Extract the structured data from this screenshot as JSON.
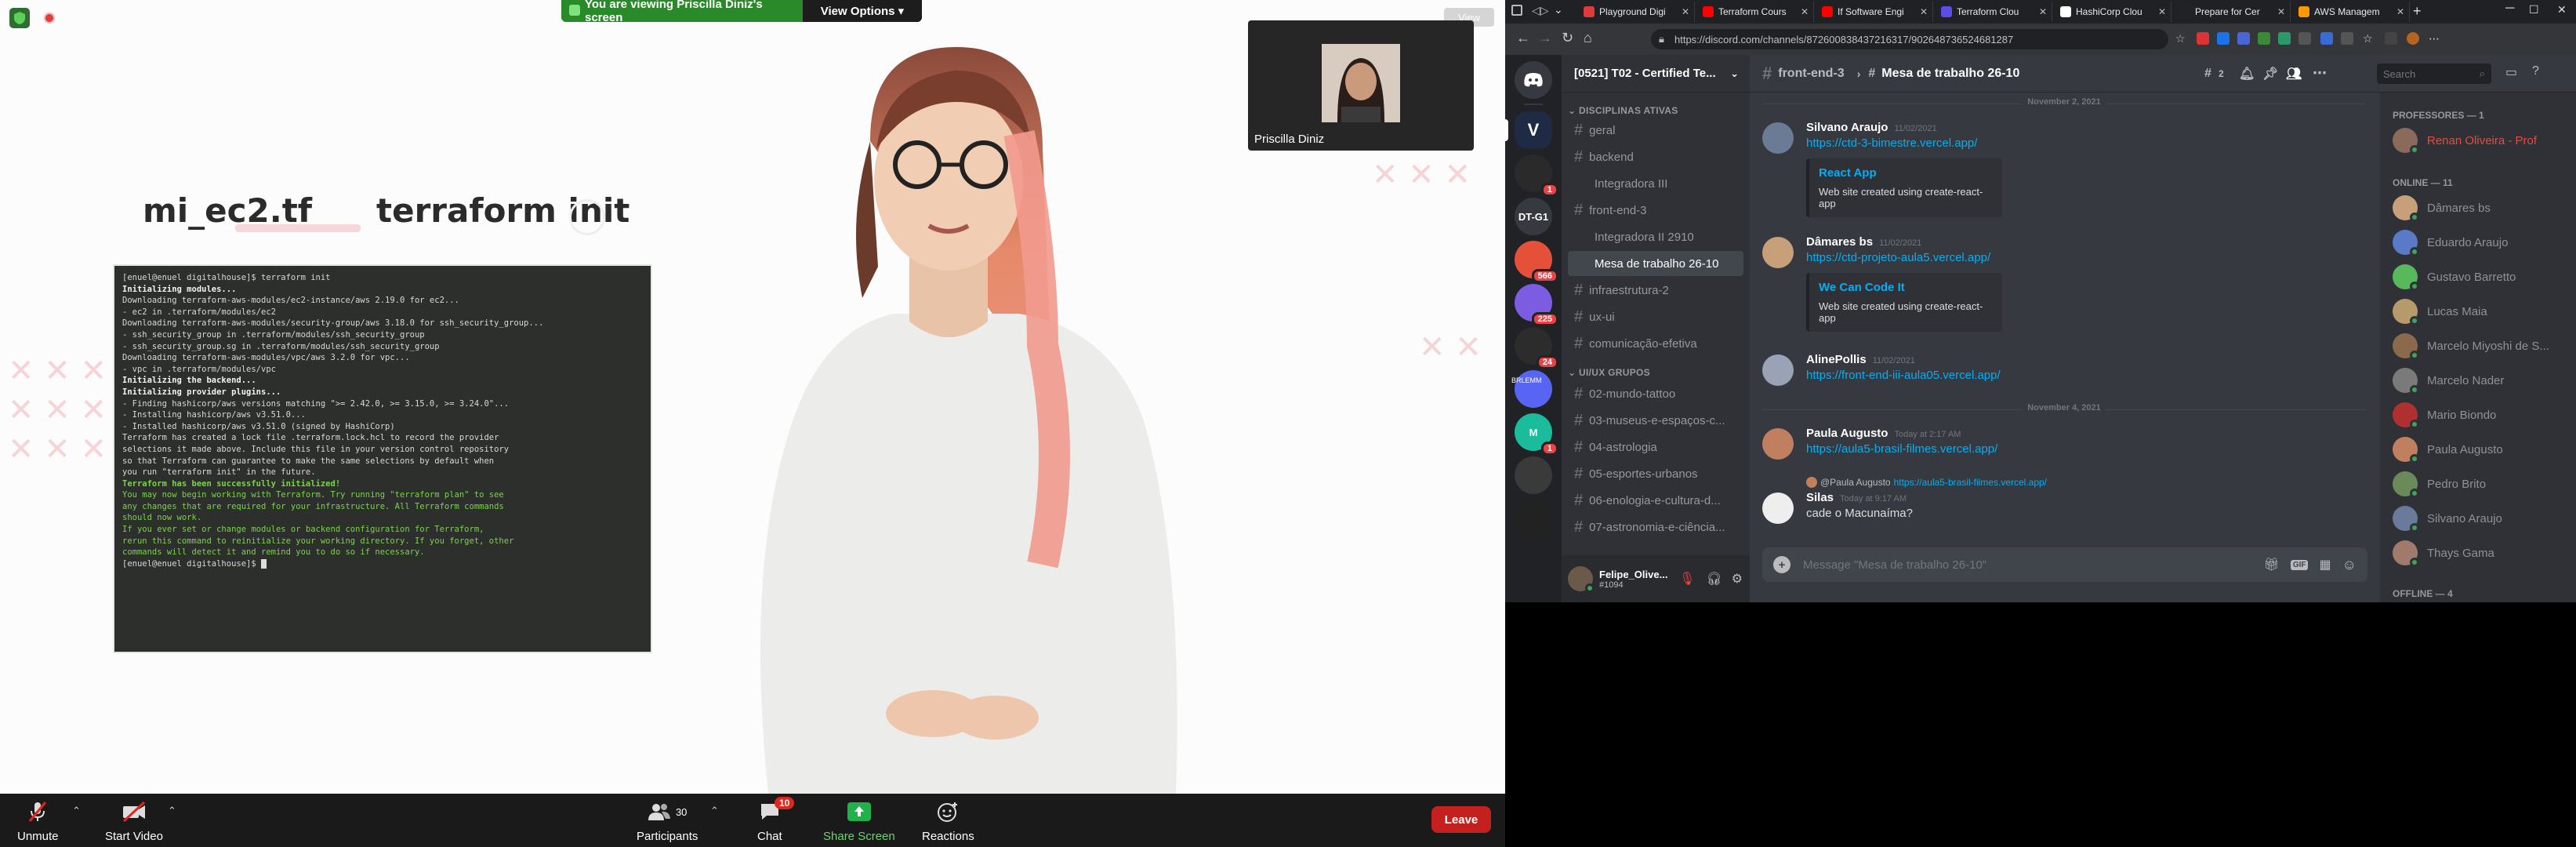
{
  "zoom": {
    "banner_text": "You are viewing Priscilla Diniz's screen",
    "view_options": "View Options",
    "view_button": "View",
    "thumbnail_name": "Priscilla Diniz",
    "slide": {
      "title_left": "mi_ec2.tf",
      "title_right": "terraform init"
    },
    "terminal_lines": [
      {
        "t": "[enuel@enuel digitalhouse]$ terraform init",
        "c": ""
      },
      {
        "t": "Initializing modules...",
        "c": "w"
      },
      {
        "t": "Downloading terraform-aws-modules/ec2-instance/aws 2.19.0 for ec2...",
        "c": ""
      },
      {
        "t": "- ec2 in .terraform/modules/ec2",
        "c": ""
      },
      {
        "t": "Downloading terraform-aws-modules/security-group/aws 3.18.0 for ssh_security_group...",
        "c": ""
      },
      {
        "t": "- ssh_security_group in .terraform/modules/ssh_security_group",
        "c": ""
      },
      {
        "t": "- ssh_security_group.sg in .terraform/modules/ssh_security_group",
        "c": ""
      },
      {
        "t": "Downloading terraform-aws-modules/vpc/aws 3.2.0 for vpc...",
        "c": ""
      },
      {
        "t": "- vpc in .terraform/modules/vpc",
        "c": ""
      },
      {
        "t": "",
        "c": ""
      },
      {
        "t": "Initializing the backend...",
        "c": "w"
      },
      {
        "t": "",
        "c": ""
      },
      {
        "t": "Initializing provider plugins...",
        "c": "w"
      },
      {
        "t": "- Finding hashicorp/aws versions matching \">= 2.42.0, >= 3.15.0, >= 3.24.0\"...",
        "c": ""
      },
      {
        "t": "- Installing hashicorp/aws v3.51.0...",
        "c": ""
      },
      {
        "t": "- Installed hashicorp/aws v3.51.0 (signed by HashiCorp)",
        "c": ""
      },
      {
        "t": "",
        "c": ""
      },
      {
        "t": "Terraform has created a lock file .terraform.lock.hcl to record the provider",
        "c": ""
      },
      {
        "t": "selections it made above. Include this file in your version control repository",
        "c": ""
      },
      {
        "t": "so that Terraform can guarantee to make the same selections by default when",
        "c": ""
      },
      {
        "t": "you run \"terraform init\" in the future.",
        "c": ""
      },
      {
        "t": "",
        "c": ""
      },
      {
        "t": "Terraform has been successfully initialized!",
        "c": "gb"
      },
      {
        "t": "",
        "c": ""
      },
      {
        "t": "You may now begin working with Terraform. Try running \"terraform plan\" to see",
        "c": "g"
      },
      {
        "t": "any changes that are required for your infrastructure. All Terraform commands",
        "c": "g"
      },
      {
        "t": "should now work.",
        "c": "g"
      },
      {
        "t": "",
        "c": ""
      },
      {
        "t": "If you ever set or change modules or backend configuration for Terraform,",
        "c": "g"
      },
      {
        "t": "rerun this command to reinitialize your working directory. If you forget, other",
        "c": "g"
      },
      {
        "t": "commands will detect it and remind you to do so if necessary.",
        "c": "g"
      },
      {
        "t": "[enuel@enuel digitalhouse]$ ",
        "c": ""
      }
    ],
    "toolbar": {
      "unmute": "Unmute",
      "start_video": "Start Video",
      "participants": "Participants",
      "participants_count": "30",
      "chat": "Chat",
      "chat_badge": "10",
      "share_screen": "Share Screen",
      "reactions": "Reactions",
      "leave": "Leave"
    }
  },
  "browser": {
    "tabs": [
      {
        "label": "Playground Digi",
        "color": "#e03b3b"
      },
      {
        "label": "Terraform Cours",
        "color": "#ff0000"
      },
      {
        "label": "If Software Engi",
        "color": "#ff0000"
      },
      {
        "label": "Terraform Clou",
        "color": "#5c4ee5"
      },
      {
        "label": "HashiCorp Clou",
        "color": "#ffffff"
      },
      {
        "label": "Prepare for Cer",
        "color": "#222222"
      },
      {
        "label": "AWS Managem",
        "color": "#ff9900"
      }
    ],
    "url": "https://discord.com/channels/872600838437216317/902648736524681287"
  },
  "discord": {
    "servers": [
      {
        "label": "V",
        "badge": ""
      },
      {
        "label": "",
        "badge": ""
      },
      {
        "label": "",
        "badge": "1"
      },
      {
        "label": "DT-G1",
        "badge": ""
      },
      {
        "label": "",
        "badge": "566"
      },
      {
        "label": "",
        "badge": "225"
      },
      {
        "label": "",
        "badge": "24"
      },
      {
        "label": "",
        "badge": ""
      },
      {
        "label": "M",
        "badge": "1"
      },
      {
        "label": "",
        "badge": ""
      },
      {
        "label": "",
        "badge": ""
      }
    ],
    "server_aux_label": "BRLEMM",
    "guild_name": "[0521] T02 - Certified Te...",
    "categories": {
      "c1": "DISCIPLINAS ATIVAS",
      "c2": "UI/UX GRUPOS"
    },
    "channels": [
      {
        "label": "geral",
        "kind": "channel"
      },
      {
        "label": "backend",
        "kind": "channel"
      },
      {
        "label": "Integradora III",
        "kind": "thread"
      },
      {
        "label": "front-end-3",
        "kind": "channel"
      },
      {
        "label": "Integradora II 2910",
        "kind": "thread"
      },
      {
        "label": "Mesa de trabalho 26-10",
        "kind": "thread-sel"
      },
      {
        "label": "infraestrutura-2",
        "kind": "channel"
      },
      {
        "label": "ux-ui",
        "kind": "channel"
      },
      {
        "label": "comunicação-efetiva",
        "kind": "channel"
      }
    ],
    "channels2": [
      {
        "label": "02-mundo-tattoo"
      },
      {
        "label": "03-museus-e-espaços-c..."
      },
      {
        "label": "04-astrologia"
      },
      {
        "label": "05-esportes-urbanos"
      },
      {
        "label": "06-enologia-e-cultura-d..."
      },
      {
        "label": "07-astronomia-e-ciência..."
      }
    ],
    "user": {
      "name": "Felipe_Olive...",
      "tag": "#1094"
    },
    "header": {
      "parent": "front-end-3",
      "thread": "Mesa de trabalho 26-10",
      "threads_count": "2",
      "search": "Search"
    },
    "dividers": {
      "d1": "November 2, 2021",
      "d2": "November 4, 2021"
    },
    "messages": {
      "m1": {
        "author": "Silvano Araujo",
        "time": "11/02/2021",
        "link": "https://ctd-3-bimestre.vercel.app/",
        "embed_title": "React App",
        "embed_desc": "Web site created using create-react-app"
      },
      "m2": {
        "author": "Dâmares bs",
        "time": "11/02/2021",
        "link": "https://ctd-projeto-aula5.vercel.app/",
        "embed_title": "We Can Code It",
        "embed_desc": "Web site created using create-react-app"
      },
      "m3": {
        "author": "AlinePollis",
        "time": "11/02/2021",
        "link": "https://front-end-iii-aula05.vercel.app/"
      },
      "m4": {
        "author": "Paula Augusto",
        "time": "Today at 2:17 AM",
        "link": "https://aula5-brasil-filmes.vercel.app/"
      },
      "m5": {
        "reply_author": "@Paula Augusto",
        "reply_link": "https://aula5-brasil-filmes.vercel.app/",
        "author": "Silas",
        "time": "Today at 9:17 AM",
        "text": "cade o Macunaíma?"
      }
    },
    "composer_placeholder": "Message \"Mesa de trabalho 26-10\"",
    "members": {
      "cat_prof": "PROFESSORES — 1",
      "prof": {
        "name": "Renan Oliveira - Prof",
        "color": "#e74c3c"
      },
      "cat_online": "ONLINE — 11",
      "online": [
        {
          "name": "Dâmares bs",
          "color": "#c7a07a"
        },
        {
          "name": "Eduardo Araujo",
          "color": "#5a7ac7"
        },
        {
          "name": "Gustavo Barretto",
          "color": "#57b85c"
        },
        {
          "name": "Lucas Maia",
          "color": "#b59a6a"
        },
        {
          "name": "Marcelo Miyoshi de S...",
          "color": "#8a6a4a"
        },
        {
          "name": "Marcelo Nader",
          "color": "#7a7a7a"
        },
        {
          "name": "Mario Biondo",
          "color": "#b03030"
        },
        {
          "name": "Paula Augusto",
          "color": "#c08060"
        },
        {
          "name": "Pedro Brito",
          "color": "#6a8a5a"
        },
        {
          "name": "Silvano Araujo",
          "color": "#6a7a9a"
        },
        {
          "name": "Thays Gama",
          "color": "#a07a6a"
        }
      ],
      "cat_offline": "OFFLINE — 4"
    }
  }
}
